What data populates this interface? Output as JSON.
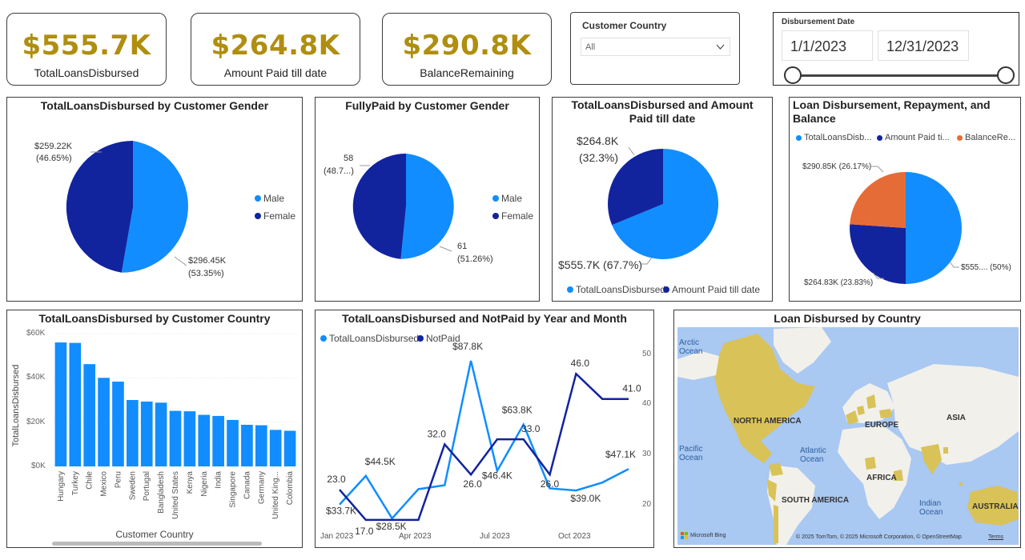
{
  "colors": {
    "light": "#118dff",
    "dark": "#12239e",
    "orange": "#e66c37",
    "kpi": "#b08e0f"
  },
  "kpis": [
    {
      "value": "$555.7K",
      "label": "TotalLoansDisbursed"
    },
    {
      "value": "$264.8K",
      "label": "Amount Paid till date"
    },
    {
      "value": "$290.8K",
      "label": "BalanceRemaining"
    }
  ],
  "country_slicer": {
    "title": "Customer Country",
    "selected": "All"
  },
  "date_slicer": {
    "title": "Disbursement Date",
    "start": "1/1/2023",
    "end": "12/31/2023"
  },
  "gender_loans": {
    "title": "TotalLoansDisbursed by Customer Gender",
    "female_label": "$259.22K",
    "female_pct": "(46.65%)",
    "male_label": "$296.45K",
    "male_pct": "(53.35%)",
    "legend": [
      "Male",
      "Female"
    ]
  },
  "gender_paid": {
    "title": "FullyPaid by Customer Gender",
    "female_label": "58",
    "female_pct": "(48.7...)",
    "male_label": "61",
    "male_pct": "(51.26%)",
    "legend": [
      "Male",
      "Female"
    ]
  },
  "loans_vs_paid": {
    "title": "TotalLoansDisbursed and Amount Paid till date",
    "paid_label": "$264.8K",
    "paid_pct": "(32.3%)",
    "total_label": "$555.7K (67.7%)",
    "legend": [
      "TotalLoansDisbursed",
      "Amount Paid till date"
    ]
  },
  "repayment": {
    "title": "Loan Disbursement, Repayment, and Balance",
    "legend": [
      "TotalLoansDisb...",
      "Amount Paid ti...",
      "BalanceRe..."
    ],
    "balance_label": "$290.85K (26.17%)",
    "paid_label": "$264.83K (23.83%)",
    "total_label": "$555.... (50%)"
  },
  "country_chart": {
    "title": "TotalLoansDisbursed by Customer Country",
    "ylabel": "TotalLoansDisbursed",
    "xlabel": "Customer Country",
    "yticks": [
      "$60K",
      "$40K",
      "$20K",
      "$0K"
    ]
  },
  "trend_chart": {
    "title": "TotalLoansDisbursed and NotPaid by Year and Month",
    "legend": [
      "TotalLoansDisbursed",
      "NotPaid"
    ],
    "xticks": [
      "Jan 2023",
      "Apr 2023",
      "Jul 2023",
      "Oct 2023"
    ],
    "y2ticks": [
      "50",
      "40",
      "30",
      "20"
    ]
  },
  "map": {
    "title": "Loan Disbursed by Country",
    "labels": {
      "arctic": "Arctic\nOcean",
      "north_america": "NORTH AMERICA",
      "europe": "EUROPE",
      "asia": "ASIA",
      "pacific": "Pacific\nOcean",
      "atlantic": "Atlantic\nOcean",
      "africa": "AFRICA",
      "south_america": "SOUTH AMERICA",
      "indian": "Indian\nOcean",
      "australia": "AUSTRALIA"
    },
    "bing": "Microsoft Bing",
    "copyright": "© 2025 TomTom, © 2025 Microsoft Corporation, © OpenStreetMap",
    "terms": "Terms"
  },
  "chart_data": [
    {
      "type": "pie",
      "title": "TotalLoansDisbursed by Customer Gender",
      "slices": [
        {
          "name": "Male",
          "value": 296.45,
          "pct": 53.35
        },
        {
          "name": "Female",
          "value": 259.22,
          "pct": 46.65
        }
      ]
    },
    {
      "type": "pie",
      "title": "FullyPaid by Customer Gender",
      "slices": [
        {
          "name": "Male",
          "value": 61,
          "pct": 51.26
        },
        {
          "name": "Female",
          "value": 58,
          "pct": 48.74
        }
      ]
    },
    {
      "type": "pie",
      "title": "TotalLoansDisbursed and Amount Paid till date",
      "slices": [
        {
          "name": "TotalLoansDisbursed",
          "value": 555.7,
          "pct": 67.7
        },
        {
          "name": "Amount Paid till date",
          "value": 264.8,
          "pct": 32.3
        }
      ]
    },
    {
      "type": "pie",
      "title": "Loan Disbursement, Repayment, and Balance",
      "slices": [
        {
          "name": "TotalLoansDisbursed",
          "value": 555.7,
          "pct": 50
        },
        {
          "name": "Amount Paid till date",
          "value": 264.83,
          "pct": 23.83
        },
        {
          "name": "BalanceRemaining",
          "value": 290.85,
          "pct": 26.17
        }
      ]
    },
    {
      "type": "bar",
      "title": "TotalLoansDisbursed by Customer Country",
      "xlabel": "Customer Country",
      "ylabel": "TotalLoansDisbursed",
      "ylim": [
        0,
        60000
      ],
      "categories": [
        "Hungary",
        "Turkey",
        "Chile",
        "Mexico",
        "Peru",
        "Sweden",
        "Portugal",
        "Bangladesh",
        "United States",
        "Kenya",
        "Nigeria",
        "India",
        "Singapore",
        "Canada",
        "Germany",
        "United King...",
        "Colombia"
      ],
      "values": [
        56000,
        55800,
        46200,
        40000,
        38300,
        30000,
        29300,
        28800,
        25100,
        24900,
        23300,
        22800,
        21000,
        18800,
        18600,
        16500,
        16100
      ]
    },
    {
      "type": "line",
      "title": "TotalLoansDisbursed and NotPaid by Year and Month",
      "x": [
        "Jan 2023",
        "Feb 2023",
        "Mar 2023",
        "Apr 2023",
        "May 2023",
        "Jun 2023",
        "Jul 2023",
        "Aug 2023",
        "Sep 2023",
        "Oct 2023",
        "Nov 2023",
        "Dec 2023"
      ],
      "series": [
        {
          "name": "TotalLoansDisbursed",
          "axis": "left",
          "values": [
            33.7,
            44.5,
            28.5,
            39.5,
            41.0,
            87.8,
            46.4,
            63.8,
            39.8,
            39.0,
            42.0,
            47.1
          ],
          "labels": [
            "$33.7K",
            "$44.5K",
            "$28.5K",
            "",
            "",
            "$87.8K",
            "$46.4K",
            "$63.8K",
            "",
            "$39.0K",
            "",
            "$47.1K"
          ]
        },
        {
          "name": "NotPaid",
          "axis": "right",
          "values": [
            23.0,
            17.0,
            17.0,
            17.0,
            32.0,
            26.0,
            33.0,
            33.0,
            26.0,
            46.0,
            41.0,
            41.0
          ],
          "labels": [
            "23.0",
            "17.0",
            "",
            "",
            "32.0",
            "26.0",
            "",
            "33.0",
            "26.0",
            "46.0",
            "",
            "41.0"
          ]
        }
      ],
      "y2ticks": [
        20,
        30,
        40,
        50
      ]
    }
  ]
}
